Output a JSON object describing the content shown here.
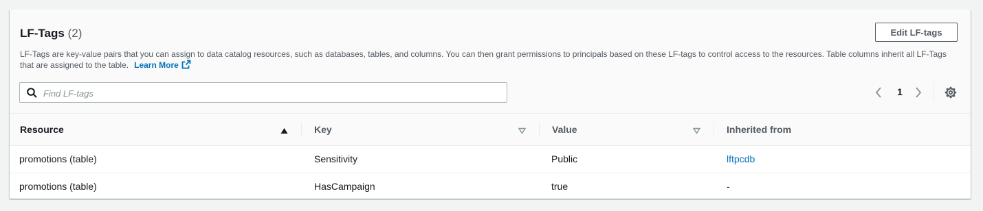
{
  "panel": {
    "title": "LF-Tags",
    "count": "(2)",
    "description": "LF-Tags are key-value pairs that you can assign to data catalog resources, such as databases, tables, and columns. You can then grant permissions to principals based on these LF-tags to control access to the resources. Table columns inherit all LF-Tags that are assigned to the table.",
    "learn_more": "Learn More",
    "edit_button": "Edit LF-tags"
  },
  "search": {
    "placeholder": "Find LF-tags",
    "value": ""
  },
  "pagination": {
    "current_page": "1"
  },
  "table": {
    "columns": [
      "Resource",
      "Key",
      "Value",
      "Inherited from"
    ],
    "sorted_column": "Resource",
    "sort_direction": "ascending",
    "rows": [
      {
        "resource": "promotions (table)",
        "key": "Sensitivity",
        "value": "Public",
        "inherited_from": "lftpcdb"
      },
      {
        "resource": "promotions (table)",
        "key": "HasCampaign",
        "value": "true",
        "inherited_from": "-"
      }
    ]
  },
  "colors": {
    "link": "#0073bb",
    "text": "#16191f",
    "secondary_text": "#545b64",
    "page_background": "#f2f3f3"
  },
  "icons": {
    "search": "search-icon",
    "external_link": "external-link-icon",
    "prev": "chevron-left-icon",
    "next": "chevron-right-icon",
    "settings": "gear-icon",
    "sort_asc": "sort-ascending-icon",
    "sort_none": "sort-caret-down-icon"
  }
}
